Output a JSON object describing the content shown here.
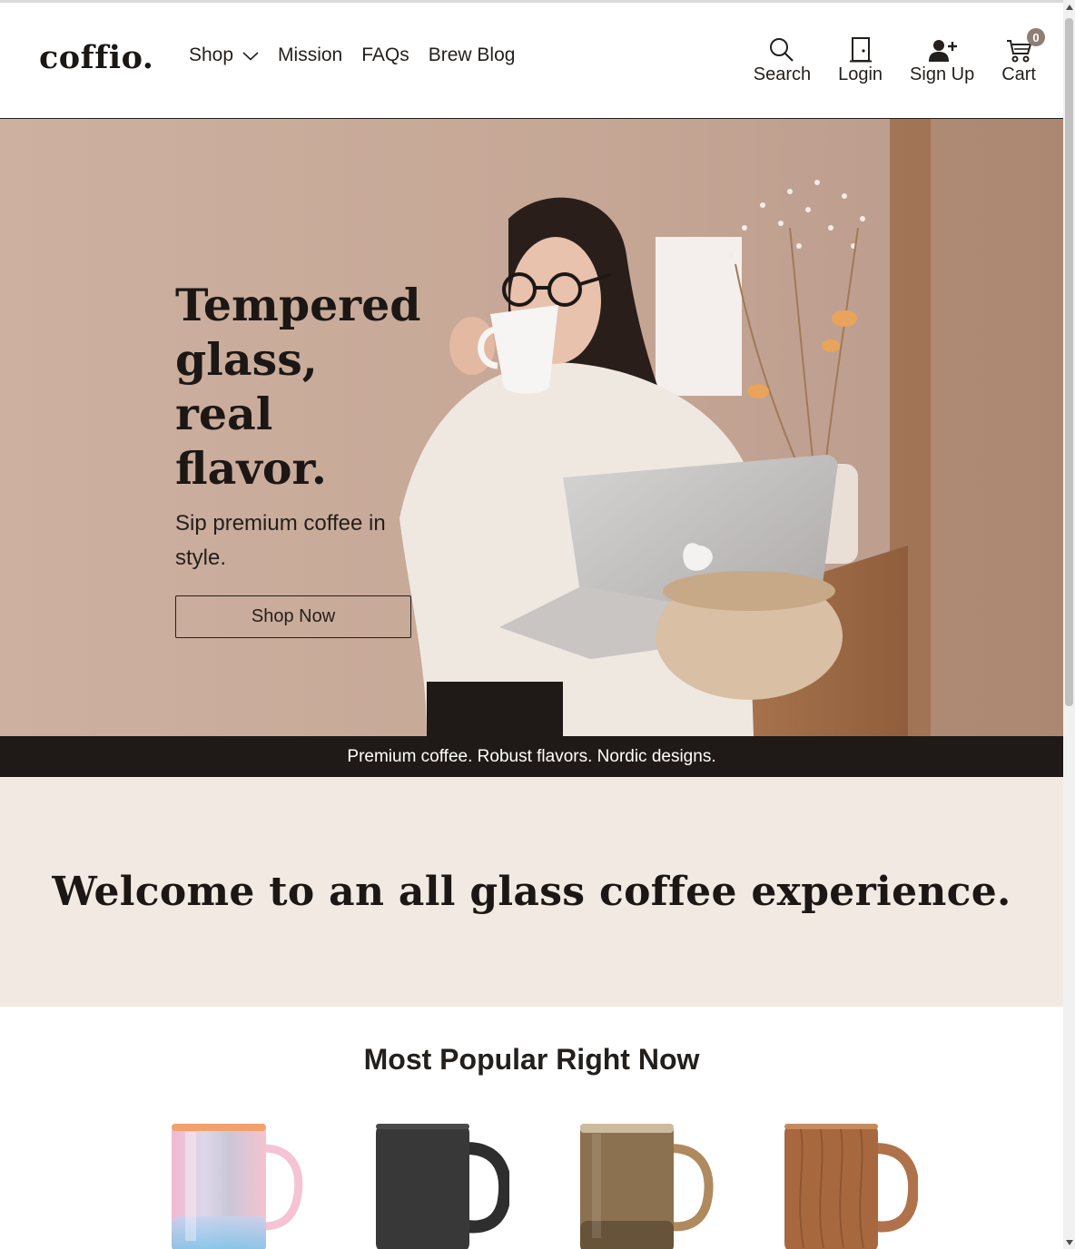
{
  "brand": {
    "logo": "coffio."
  },
  "nav": {
    "items": [
      {
        "label": "Shop",
        "has_dropdown": true
      },
      {
        "label": "Mission"
      },
      {
        "label": "FAQs"
      },
      {
        "label": "Brew Blog"
      }
    ]
  },
  "actions": {
    "search": {
      "label": "Search",
      "icon": "search-icon"
    },
    "login": {
      "label": "Login",
      "icon": "door-icon"
    },
    "signup": {
      "label": "Sign Up",
      "icon": "add-user-icon"
    },
    "cart": {
      "label": "Cart",
      "icon": "cart-icon",
      "count": "0"
    }
  },
  "hero": {
    "title": "Tempered glass, real flavor.",
    "subtitle": "Sip premium coffee in style.",
    "cta": "Shop Now",
    "image": "woman-drinking-coffee-with-laptop"
  },
  "banner": {
    "text": "Premium coffee. Robust flavors. Nordic designs."
  },
  "welcome": {
    "title": "Welcome to an all glass coffee experience."
  },
  "popular": {
    "title": "Most Popular Right Now",
    "products": [
      {
        "name": "iridescent-glass-mug"
      },
      {
        "name": "black-mug"
      },
      {
        "name": "smoked-amber-glass-mug"
      },
      {
        "name": "wood-grain-mug"
      }
    ]
  },
  "colors": {
    "text": "#231f1c",
    "banner_bg": "#1f1a17",
    "welcome_bg": "#f2e9e3",
    "hero_bg": "#c9ab9a",
    "badge_bg": "#8e7f75"
  }
}
